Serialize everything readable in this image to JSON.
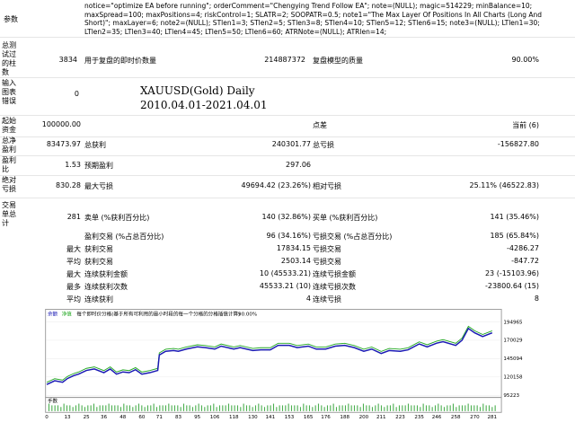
{
  "params": {
    "label": "参数",
    "text": "notice=\"optimize EA before running\"; orderComment=\"Chengying Trend Follow EA\"; note=(NULL); magic=514229; minBalance=10; maxSpread=100; maxPositions=4; riskControl=1; SLATR=2; SOOPATR=0.5; note1=\"The Max Layer Of Positions In All Charts (Long And Short)\"; maxLayer=6; note2=(NULL); STlen1=3; STlen2=5; STlen3=8; STlen4=10; STlen5=12; STlen6=15; note3=(NULL); LTlen1=30; LTlen2=35; LTlen3=40; LTlen4=45; LTlen5=50; LTlen6=60; ATRNote=(NULL); ATRlen=14;"
  },
  "row1": {
    "label": "总测试过的柱数",
    "bars": "3834",
    "ticks_label": "用于复盘的即时价数量",
    "ticks": "214887372",
    "quality_label": "复盘模型的质量",
    "quality": "90.00%"
  },
  "row2": {
    "label": "输入图表错误",
    "errors": "0",
    "symbol": "XAUUSD(Gold) Daily",
    "period": "2010.04.01-2021.04.01"
  },
  "row3": {
    "label": "起始资金",
    "deposit": "100000.00",
    "spread_label": "点差",
    "spread": "当前 (6)"
  },
  "row4": {
    "label": "总净盈利",
    "net": "83473.97",
    "gross_profit_label": "总获利",
    "gross_profit": "240301.77",
    "gross_loss_label": "总亏损",
    "gross_loss": "-156827.80"
  },
  "row5": {
    "label": "盈利比",
    "pf": "1.53",
    "payoff_label": "预期盈利",
    "payoff": "297.06"
  },
  "row6": {
    "label": "绝对亏损",
    "abs_dd": "830.28",
    "max_dd_label": "最大亏损",
    "max_dd": "49694.42 (23.26%)",
    "rel_dd_label": "相对亏损",
    "rel_dd": "25.11% (46522.83)"
  },
  "row7": {
    "label": "交易单总计",
    "trades": "281",
    "short_label": "卖单 (%获利百分比)",
    "short": "140 (32.86%)",
    "long_label": "买单 (%获利百分比)",
    "long": "141 (35.46%)"
  },
  "stats": [
    {
      "l1": "",
      "t1": "盈利交易 (%占总百分比)",
      "v1": "96 (34.16%)",
      "t2": "亏损交易 (%占总百分比)",
      "v2": "185 (65.84%)"
    },
    {
      "l1": "最大",
      "t1": "获利交易",
      "v1": "17834.15",
      "t2": "亏损交易",
      "v2": "-4286.27"
    },
    {
      "l1": "平均",
      "t1": "获利交易",
      "v1": "2503.14",
      "t2": "亏损交易",
      "v2": "-847.72"
    },
    {
      "l1": "最大",
      "t1": "连续获利金额",
      "v1": "10 (45533.21)",
      "t2": "连续亏损金额",
      "v2": "23 (-15103.96)"
    },
    {
      "l1": "最多",
      "t1": "连续获利次数",
      "v1": "45533.21 (10)",
      "t2": "连续亏损次数",
      "v2": "-23800.64 (15)"
    },
    {
      "l1": "平均",
      "t1": "连续获利",
      "v1": "4",
      "t2": "连续亏损",
      "v2": "8"
    }
  ],
  "chart_header": {
    "balance": "余额",
    "equity": "净值",
    "desc": "每个即时价分格(基于所有可利用的最小时段的每一个分格的分格插值计算)",
    "quality": "90.00%"
  },
  "volume_label": "手数",
  "colors": {
    "balance": "#1a1ab4",
    "equity": "#22a822",
    "volume": "#4caf50"
  },
  "chart_data": {
    "type": "line",
    "y_ticks": [
      95223,
      120158,
      145094,
      170029,
      194965
    ],
    "x_ticks": [
      0,
      13,
      25,
      36,
      48,
      60,
      71,
      83,
      95,
      106,
      118,
      130,
      141,
      153,
      165,
      176,
      188,
      200,
      211,
      223,
      235,
      246,
      258,
      270,
      281
    ],
    "ylim": [
      95223,
      199000
    ],
    "xlim": [
      0,
      285
    ],
    "series": [
      {
        "name": "余额",
        "x": [
          0,
          5,
          10,
          13,
          17,
          20,
          25,
          30,
          36,
          40,
          44,
          48,
          52,
          56,
          60,
          65,
          70,
          71,
          75,
          80,
          83,
          88,
          95,
          100,
          106,
          110,
          118,
          122,
          130,
          135,
          141,
          146,
          153,
          158,
          165,
          170,
          176,
          182,
          188,
          194,
          200,
          205,
          211,
          216,
          223,
          228,
          235,
          240,
          246,
          250,
          258,
          262,
          266,
          270,
          275,
          281
        ],
        "y": [
          110000,
          115000,
          113000,
          118000,
          122000,
          124000,
          129000,
          131000,
          126000,
          131000,
          124000,
          127000,
          126000,
          130000,
          124000,
          126000,
          129000,
          150000,
          155000,
          156000,
          155000,
          158000,
          161000,
          160000,
          158000,
          162000,
          158000,
          160000,
          156000,
          157000,
          157000,
          163000,
          163000,
          160000,
          162000,
          158000,
          158000,
          162000,
          163000,
          160000,
          155000,
          158000,
          152000,
          156000,
          155000,
          157000,
          165000,
          161000,
          166000,
          168000,
          163000,
          170000,
          186000,
          180000,
          175000,
          180000
        ]
      }
    ]
  }
}
